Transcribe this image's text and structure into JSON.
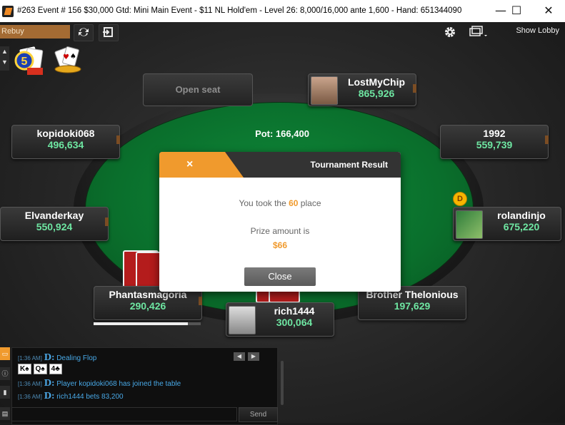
{
  "window": {
    "title": "#263 Event # 156 $30,000 Gtd: Mini Main Event - $11 NL Hold'em - Level 26: 8,000/16,000 ante 1,600 - Hand: 651344090",
    "minimize": "—",
    "maximize": "☐",
    "close": "✕"
  },
  "toolbar": {
    "rebuy_label": "Rebuy",
    "show_lobby_label": "Show Lobby",
    "icons": [
      "refresh-icon",
      "exit-seat-icon",
      "gear-icon",
      "window-layout-icon"
    ]
  },
  "table": {
    "pot_label": "Pot: 166,400",
    "open_seat_label": "Open seat",
    "dealer_button": "D",
    "seats": [
      {
        "name": "LostMyChip",
        "stack": "865,926"
      },
      {
        "name": "kopidoki068",
        "stack": "496,634"
      },
      {
        "name": "1992",
        "stack": "559,739"
      },
      {
        "name": "Elvanderkay",
        "stack": "550,924"
      },
      {
        "name": "rolandinjo",
        "stack": "675,220"
      },
      {
        "name": "Phantasmagoria",
        "stack": "290,426"
      },
      {
        "name": "Brother Thelonious",
        "stack": "197,629"
      },
      {
        "name": "rich1444",
        "stack": "300,064"
      }
    ],
    "timebank_fraction": 0.88
  },
  "modal": {
    "close_x": "×",
    "title": "Tournament Result",
    "line1_prefix": "You took the ",
    "place": "60",
    "line1_suffix": " place",
    "line2": "Prize amount is",
    "prize": "$66",
    "close_button": "Close"
  },
  "chat": {
    "lines": [
      {
        "time": "[1:36 AM]",
        "dealer": "D:",
        "text": "Dealing Flop"
      },
      {
        "time": "[1:36 AM]",
        "dealer": "D:",
        "text": "Player kopidoki068  has joined the table"
      },
      {
        "time": "[1:36 AM]",
        "dealer": "D:",
        "text": "rich1444  bets 83,200"
      }
    ],
    "flop_cards": [
      "K♠",
      "Q♠",
      "4♣"
    ],
    "send_label": "Send",
    "nav_prev": "◀",
    "nav_next": "▶"
  },
  "colors": {
    "felt": "#0a6f2c",
    "accent_orange": "#f09a2d",
    "stack_green": "#6ee6a2",
    "chat_blue": "#48a8e6",
    "rebuy_bg": "#a46b33"
  }
}
